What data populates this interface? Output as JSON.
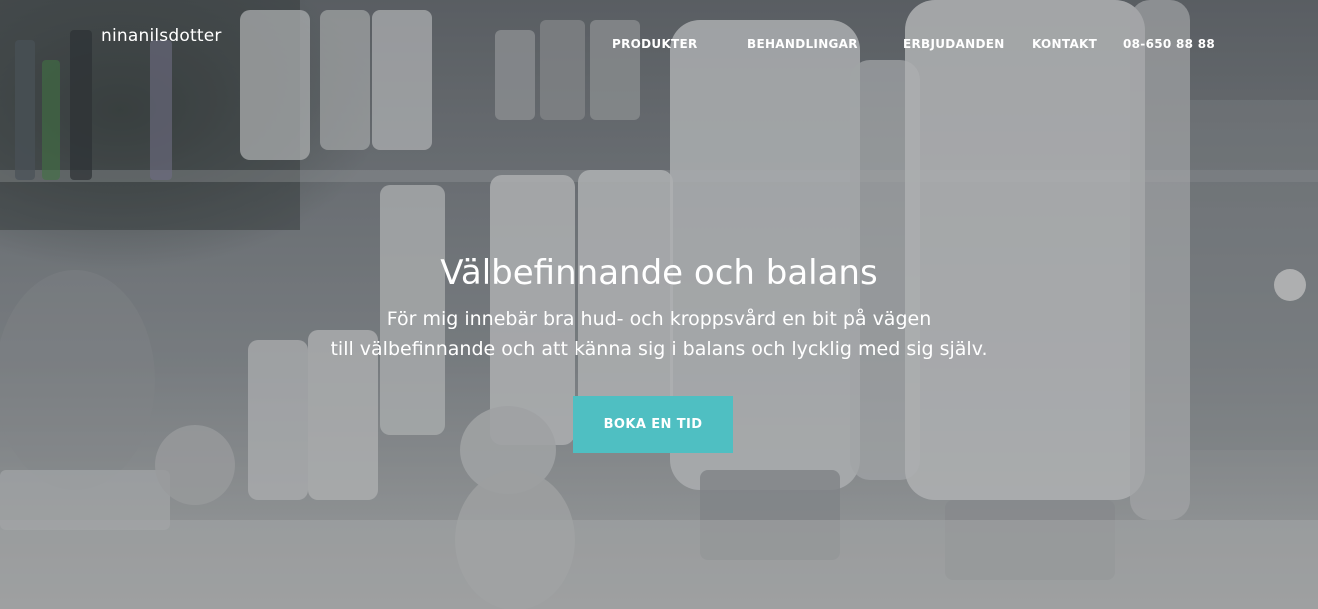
{
  "brand": {
    "name": "ninanilsdotter"
  },
  "nav": {
    "items": [
      {
        "label": "PRODUKTER"
      },
      {
        "label": "BEHANDLINGAR"
      },
      {
        "label": "ERBJUDANDEN"
      },
      {
        "label": "KONTAKT"
      },
      {
        "label": "08-650 88 88"
      }
    ]
  },
  "hero": {
    "title": "Välbefinnande och balans",
    "lead_line_1": "För mig innebär bra hud- och kroppsvård en bit på vägen",
    "lead_line_2": "till välbefinnande och att känna sig i balans och lycklig med sig själv.",
    "cta_label": "BOKA EN TID"
  },
  "colors": {
    "accent": "#4fbfc2",
    "text": "#ffffff"
  },
  "icons": {
    "background": "skincare-products-shelf-photo"
  }
}
